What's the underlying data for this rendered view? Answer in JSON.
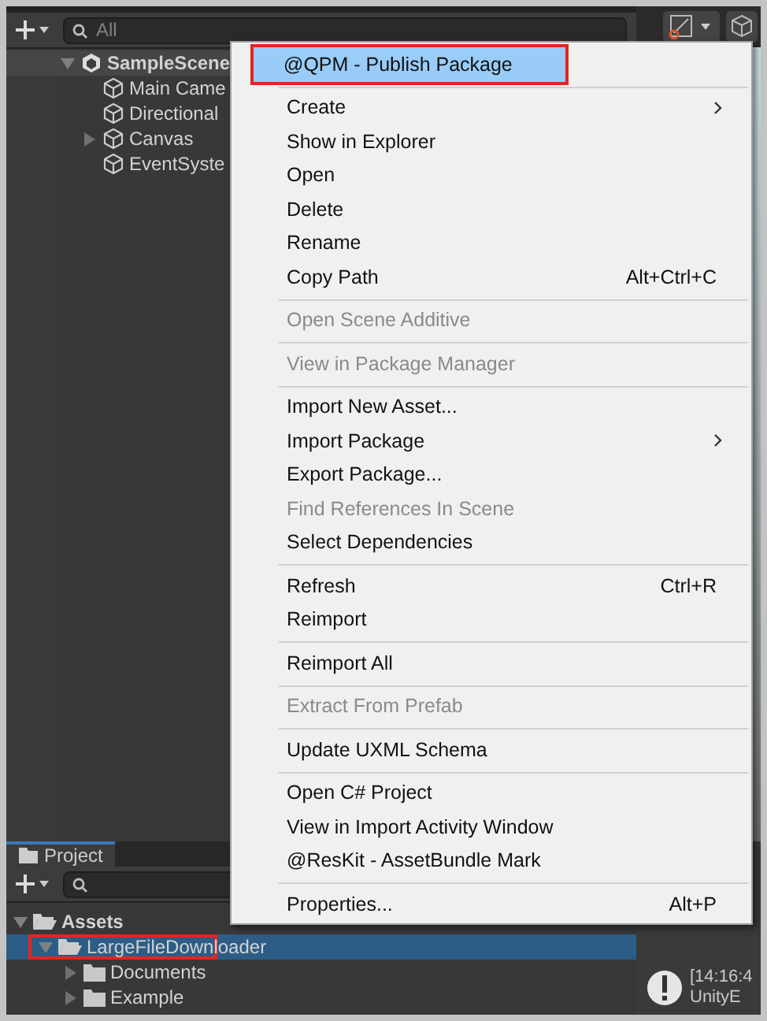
{
  "hierarchy": {
    "search": {
      "placeholder": "All"
    },
    "items": [
      {
        "label": "SampleScene",
        "kind": "scene",
        "expanded": true,
        "selected": true,
        "children": [
          {
            "label": "Main Came",
            "kind": "object"
          },
          {
            "label": "Directional",
            "kind": "object"
          },
          {
            "label": "Canvas",
            "kind": "object",
            "collapsed": true
          },
          {
            "label": "EventSyste",
            "kind": "object"
          }
        ]
      }
    ]
  },
  "context_menu": {
    "items": [
      {
        "kind": "item",
        "label": "@QPM - Publish Package",
        "selected": true,
        "outlined": true
      },
      {
        "kind": "separator"
      },
      {
        "kind": "item",
        "label": "Create",
        "submenu": true
      },
      {
        "kind": "item",
        "label": "Show in Explorer"
      },
      {
        "kind": "item",
        "label": "Open"
      },
      {
        "kind": "item",
        "label": "Delete"
      },
      {
        "kind": "item",
        "label": "Rename"
      },
      {
        "kind": "item",
        "label": "Copy Path",
        "shortcut": "Alt+Ctrl+C"
      },
      {
        "kind": "separator"
      },
      {
        "kind": "item",
        "label": "Open Scene Additive",
        "disabled": true
      },
      {
        "kind": "separator"
      },
      {
        "kind": "item",
        "label": "View in Package Manager",
        "disabled": true
      },
      {
        "kind": "separator"
      },
      {
        "kind": "item",
        "label": "Import New Asset..."
      },
      {
        "kind": "item",
        "label": "Import Package",
        "submenu": true
      },
      {
        "kind": "item",
        "label": "Export Package..."
      },
      {
        "kind": "item",
        "label": "Find References In Scene",
        "disabled": true
      },
      {
        "kind": "item",
        "label": "Select Dependencies"
      },
      {
        "kind": "separator"
      },
      {
        "kind": "item",
        "label": "Refresh",
        "shortcut": "Ctrl+R"
      },
      {
        "kind": "item",
        "label": "Reimport"
      },
      {
        "kind": "separator"
      },
      {
        "kind": "item",
        "label": "Reimport All"
      },
      {
        "kind": "separator"
      },
      {
        "kind": "item",
        "label": "Extract From Prefab",
        "disabled": true
      },
      {
        "kind": "separator"
      },
      {
        "kind": "item",
        "label": "Update UXML Schema"
      },
      {
        "kind": "separator"
      },
      {
        "kind": "item",
        "label": "Open C# Project"
      },
      {
        "kind": "item",
        "label": "View in Import Activity Window"
      },
      {
        "kind": "item",
        "label": "@ResKit - AssetBundle Mark"
      },
      {
        "kind": "separator"
      },
      {
        "kind": "item",
        "label": "Properties...",
        "shortcut": "Alt+P"
      }
    ]
  },
  "project": {
    "tab": "Project",
    "items": [
      {
        "label": "Assets",
        "expanded": true,
        "children": [
          {
            "label": "LargeFileDownloader",
            "expanded": true,
            "selected": true,
            "outlined": true,
            "children": [
              {
                "label": "Documents",
                "expanded": false
              },
              {
                "label": "Example",
                "expanded": false
              }
            ]
          }
        ]
      }
    ]
  },
  "console": {
    "entries": [
      {
        "time": "[14:16:4",
        "source": "UnityE"
      }
    ]
  }
}
